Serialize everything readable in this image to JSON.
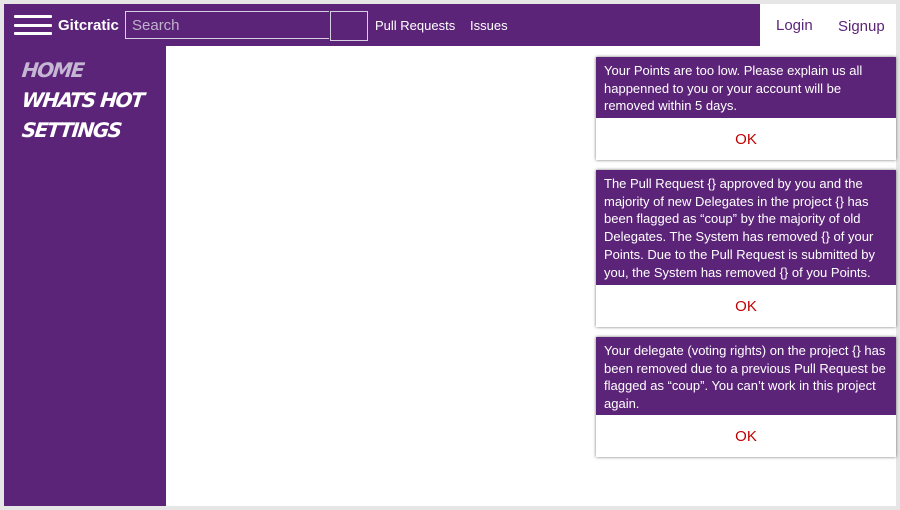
{
  "app": {
    "brand": "Gitcratic"
  },
  "search": {
    "placeholder": "Search"
  },
  "nav": {
    "links": [
      "Pull Requests",
      "Issues"
    ]
  },
  "auth": {
    "login": "Login",
    "signup": "Signup"
  },
  "sidebar": {
    "items": [
      {
        "label": "Home",
        "active": true
      },
      {
        "label": "Whats Hot",
        "active": false
      },
      {
        "label": "Settings",
        "active": false
      }
    ]
  },
  "notifications": [
    {
      "message": "Your Points are too low. Please explain us all happenned to you or your account will be removed within 5 days.",
      "button": "OK"
    },
    {
      "message": "The Pull Request {} approved by you and the majority of new Delegates in the project {} has been flagged as “coup” by the majority of old Delegates. The System has removed {} of your Points. Due to the Pull Request is submitted by you, the System has removed {} of you Points.",
      "button": "OK"
    },
    {
      "message": "Your delegate (voting rights) on the project {} has been removed due to a previous Pull Request be flagged as “coup”. You can’t work in this project again.",
      "button": "OK"
    }
  ],
  "colors": {
    "brand_purple": "#5c2478",
    "ok_red": "#c00000",
    "inactive_sidebar": "#c5b6d4"
  },
  "icons": {
    "menu": "hamburger-menu-icon"
  }
}
